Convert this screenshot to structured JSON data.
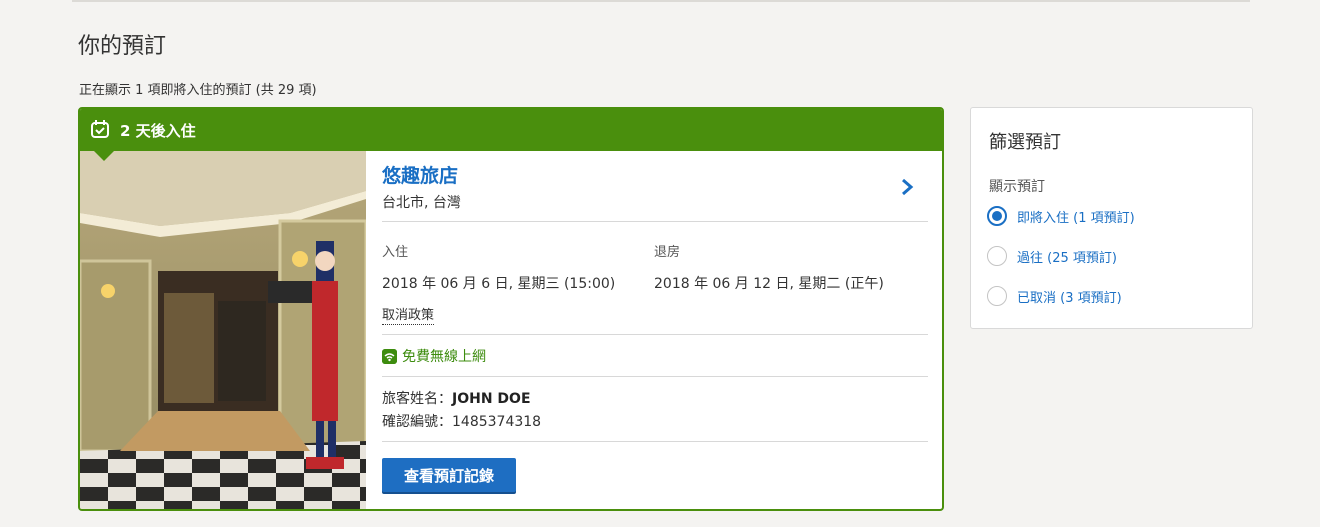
{
  "page": {
    "title": "你的預訂",
    "summary": "正在顯示 1 項即將入住的預訂 (共 29 項)"
  },
  "booking": {
    "banner": "2 天後入住",
    "hotel_name": "悠趣旅店",
    "location": "台北市, 台灣",
    "checkin_label": "入住",
    "checkin_value": "2018 年 06 月 6 日, 星期三 (15:00)",
    "checkout_label": "退房",
    "checkout_value": "2018 年 06 月 12 日, 星期二 (正午)",
    "cancel_policy": "取消政策",
    "amenity": "免費無線上網",
    "guest_label": "旅客姓名：",
    "guest_name": "JOHN DOE",
    "conf_label": "確認編號：",
    "conf_number": "1485374318",
    "view_button": "查看預訂記錄"
  },
  "filter": {
    "title": "篩選預訂",
    "subtitle": "顯示預訂",
    "options": [
      {
        "label": "即將入住 (1 項預訂)",
        "selected": true
      },
      {
        "label": "過往 (25 項預訂)",
        "selected": false
      },
      {
        "label": "已取消 (3 項預訂)",
        "selected": false
      }
    ]
  },
  "colors": {
    "accent_green": "#4a8f0d",
    "link_blue": "#1a6fc4",
    "button_blue": "#1e6ec2"
  }
}
